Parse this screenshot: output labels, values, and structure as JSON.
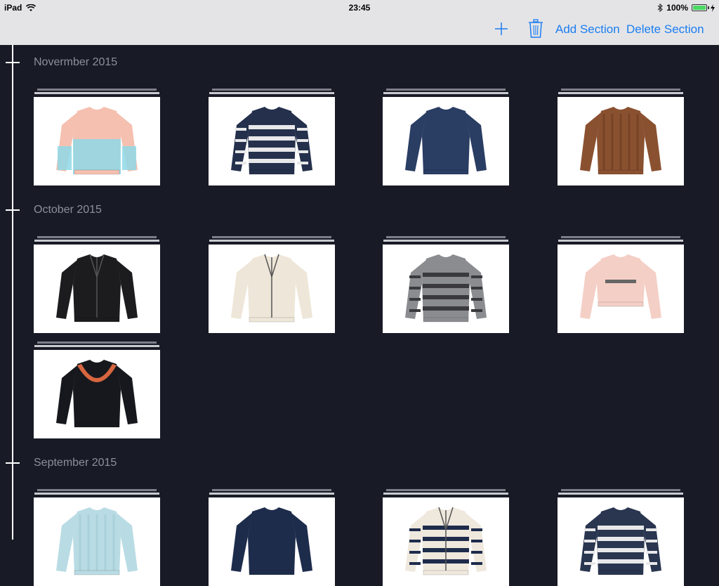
{
  "status_bar": {
    "device": "iPad",
    "time": "23:45",
    "battery": "100%",
    "icons": [
      "wifi-icon",
      "bluetooth-icon",
      "battery-icon",
      "charging-icon"
    ]
  },
  "toolbar": {
    "add_icon": "plus-icon",
    "delete_icon": "trash-icon",
    "add_section_label": "Add Section",
    "delete_section_label": "Delete Section",
    "accent_color": "#1a7df2"
  },
  "sections": [
    {
      "title": "Novermber 2015",
      "items": [
        {
          "name": "pastel-ombre-sweater",
          "color": "#f5c0b0",
          "color2": "#8ed8e6"
        },
        {
          "name": "navy-fair-isle-sweater",
          "color": "#24304c",
          "color2": "#e8e8ea"
        },
        {
          "name": "navy-knit-sweater",
          "color": "#2a3d63",
          "color2": "#2a3d63"
        },
        {
          "name": "brown-cable-knit-sweater",
          "color": "#8a5130",
          "color2": "#6e3e22"
        }
      ]
    },
    {
      "title": "October 2015",
      "items": [
        {
          "name": "black-blazer",
          "color": "#1c1c1e",
          "color2": "#ffffff"
        },
        {
          "name": "cream-faux-fur-jacket",
          "color": "#eee6d8",
          "color2": "#d8cdb8"
        },
        {
          "name": "grey-fair-isle-sweater",
          "color": "#8a8c90",
          "color2": "#3a3a3e"
        },
        {
          "name": "pink-cropped-sweatshirt",
          "color": "#f4cfc6",
          "color2": "#e6b8ad"
        },
        {
          "name": "black-embroidered-sweatshirt",
          "color": "#17181d",
          "color2": "#d76640"
        }
      ]
    },
    {
      "title": "September 2015",
      "items": [
        {
          "name": "light-blue-cable-sweater",
          "color": "#b9dce4",
          "color2": "#a5ccd6"
        },
        {
          "name": "navy-cable-sweater",
          "color": "#1e2c4c",
          "color2": "#1e2c4c"
        },
        {
          "name": "nordic-hooded-cardigan",
          "color": "#efe8dd",
          "color2": "#1e2c4c"
        },
        {
          "name": "navy-white-pattern-sweater",
          "color": "#2a3650",
          "color2": "#e8e8ea"
        }
      ]
    }
  ]
}
